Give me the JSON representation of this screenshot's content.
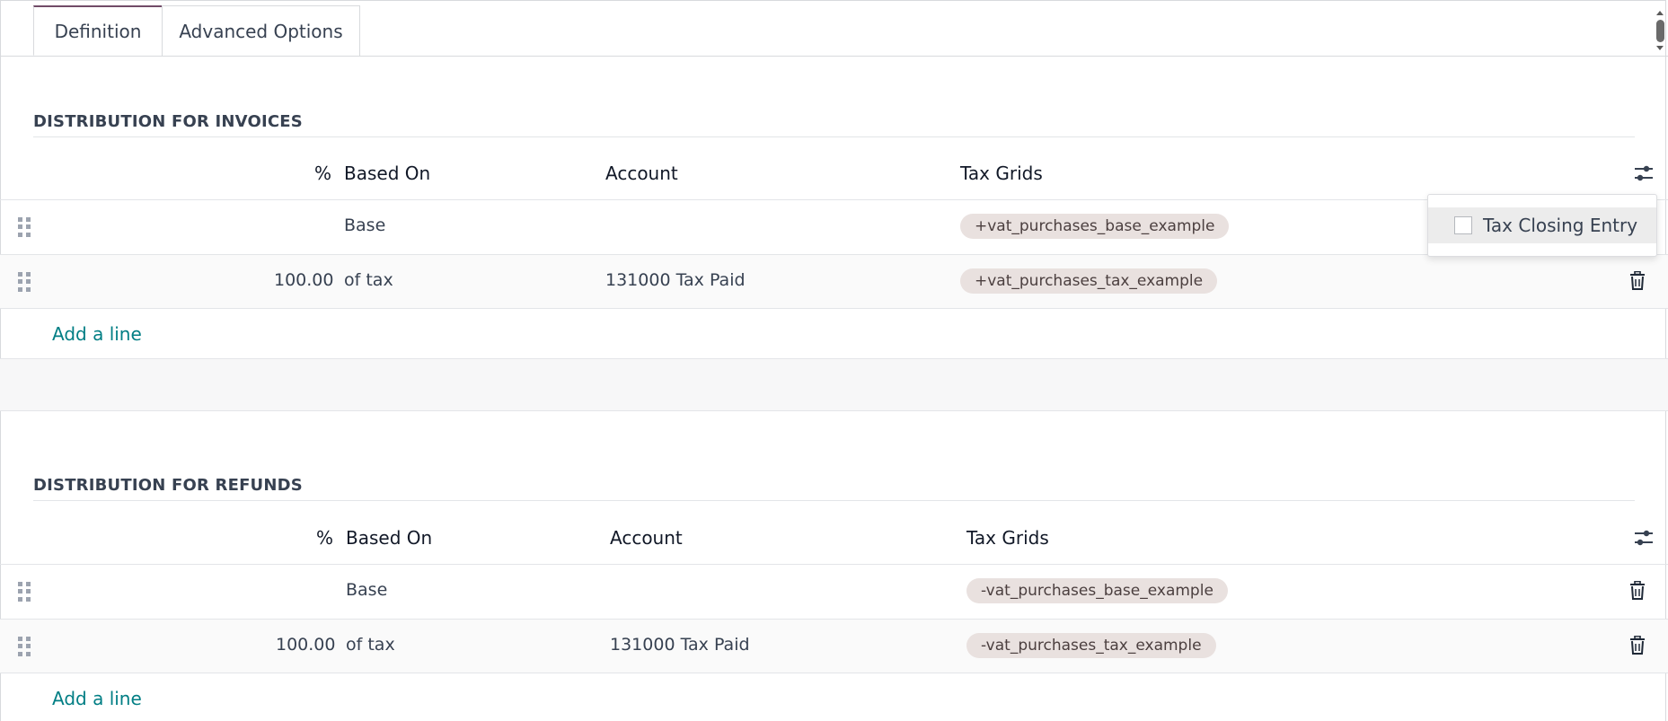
{
  "tabs": [
    {
      "label": "Definition",
      "active": true
    },
    {
      "label": "Advanced Options",
      "active": false
    }
  ],
  "columns": {
    "percent": "%",
    "based_on": "Based On",
    "account": "Account",
    "tax_grids": "Tax Grids"
  },
  "invoices": {
    "title": "DISTRIBUTION FOR INVOICES",
    "rows": [
      {
        "percent": "",
        "based_on": "Base",
        "account": "",
        "tax_grid": "+vat_purchases_base_example"
      },
      {
        "percent": "100.00",
        "based_on": "of tax",
        "account": "131000 Tax Paid",
        "tax_grid": "+vat_purchases_tax_example"
      }
    ],
    "add_line": "Add a line"
  },
  "refunds": {
    "title": "DISTRIBUTION FOR REFUNDS",
    "rows": [
      {
        "percent": "",
        "based_on": "Base",
        "account": "",
        "tax_grid": "-vat_purchases_base_example"
      },
      {
        "percent": "100.00",
        "based_on": "of tax",
        "account": "131000 Tax Paid",
        "tax_grid": "-vat_purchases_tax_example"
      }
    ],
    "add_line": "Add a line"
  },
  "optional_columns_dropdown": {
    "items": [
      {
        "label": "Tax Closing Entry",
        "checked": false
      }
    ]
  },
  "icons": {
    "drag_handle": "drag-handle-icon",
    "trash": "trash-icon",
    "optional_columns": "sliders-icon"
  },
  "colors": {
    "link": "#017e84",
    "tag_bg": "#e9e1df",
    "active_tab_accent": "#714b67"
  }
}
